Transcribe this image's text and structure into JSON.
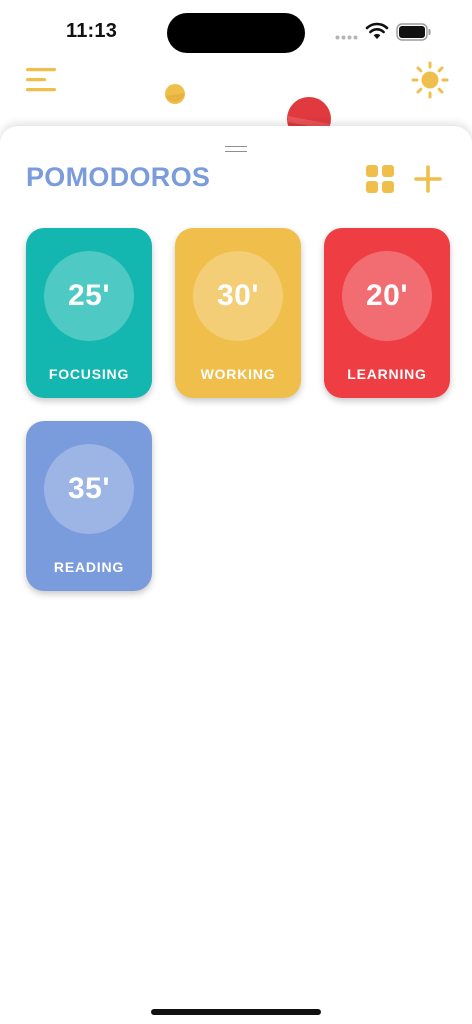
{
  "status_bar": {
    "time": "11:13"
  },
  "icons": {
    "menu": "hamburger-menu-icon",
    "theme": "sun-icon",
    "grid": "grid-view-icon",
    "add": "plus-icon"
  },
  "colors": {
    "accent_yellow": "#f0be4a",
    "title_blue": "#7b9cdc",
    "teal": "#13b7b0",
    "red": "#ee3d43",
    "blue": "#7b9cdc"
  },
  "sheet": {
    "title": "POMODOROS"
  },
  "pomodoros": [
    {
      "minutes": "25'",
      "label": "FOCUSING",
      "color": "#13b7b0"
    },
    {
      "minutes": "30'",
      "label": "WORKING",
      "color": "#f0be4a"
    },
    {
      "minutes": "20'",
      "label": "LEARNING",
      "color": "#ee3d43"
    },
    {
      "minutes": "35'",
      "label": "READING",
      "color": "#7b9cdc"
    }
  ]
}
